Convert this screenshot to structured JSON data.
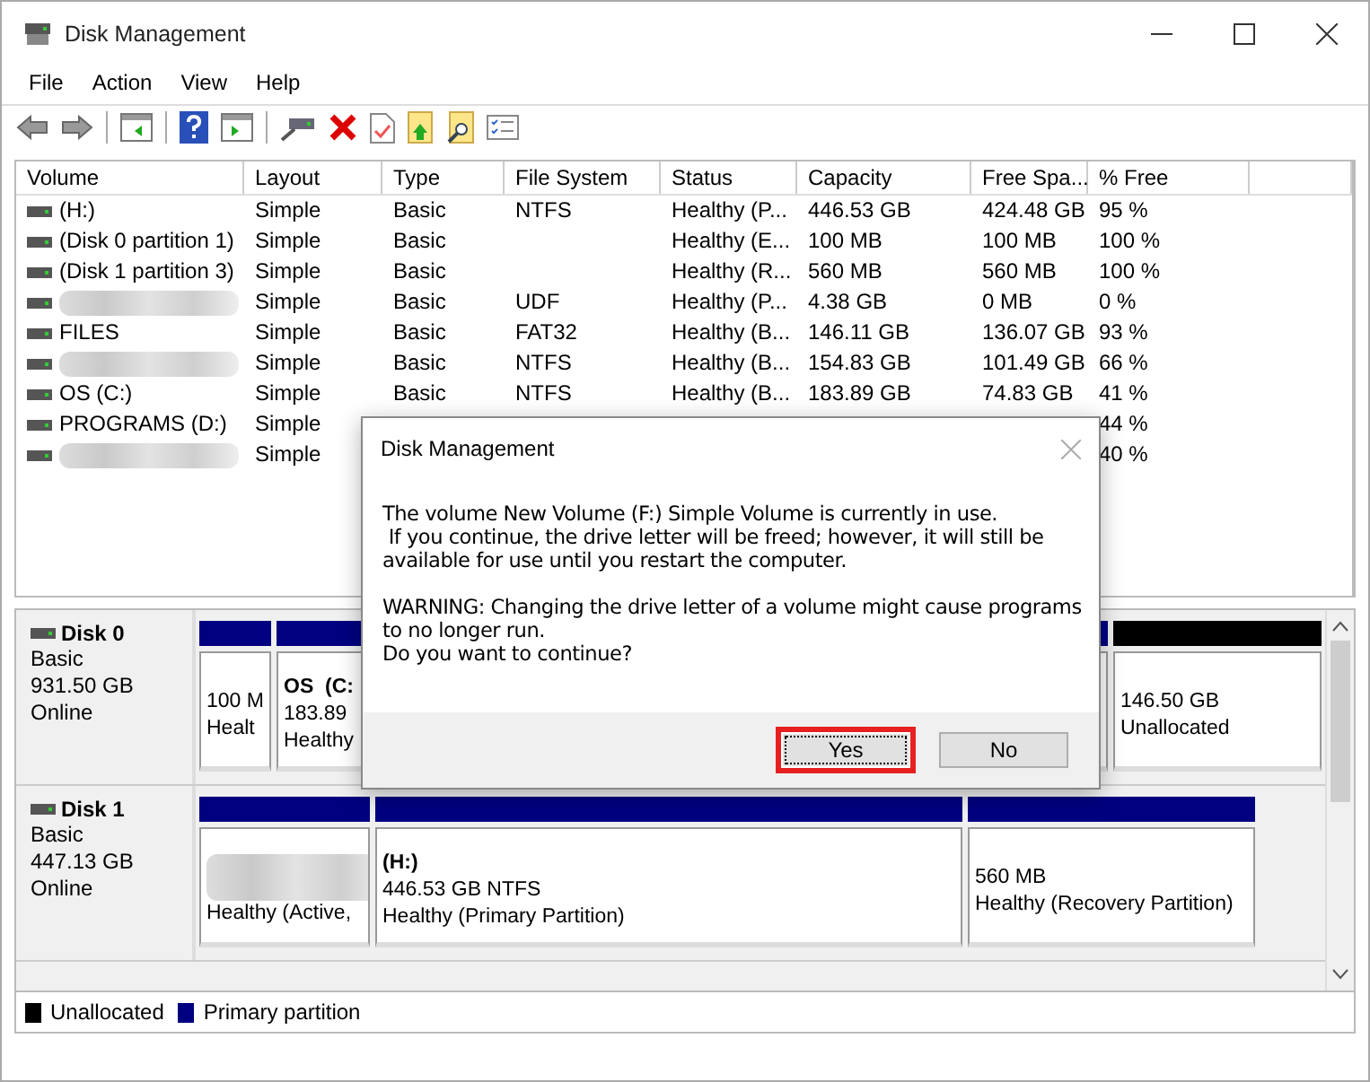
{
  "window": {
    "title": "Disk Management"
  },
  "menu": [
    "File",
    "Action",
    "View",
    "Help"
  ],
  "volumes": {
    "columns": [
      "Volume",
      "Layout",
      "Type",
      "File System",
      "Status",
      "Capacity",
      "Free Spa...",
      "% Free"
    ],
    "rows": [
      {
        "volume": "(H:)",
        "layout": "Simple",
        "type": "Basic",
        "file_system": "NTFS",
        "status": "Healthy (P...",
        "capacity": "446.53 GB",
        "free_space": "424.48 GB",
        "percent_free": "95 %"
      },
      {
        "volume": "(Disk 0 partition 1)",
        "layout": "Simple",
        "type": "Basic",
        "status": "Healthy (E...",
        "capacity": "100 MB",
        "free_space": "100 MB",
        "percent_free": "100 %"
      },
      {
        "volume": "(Disk 1 partition 3)",
        "layout": "Simple",
        "type": "Basic",
        "status": "Healthy (R...",
        "capacity": "560 MB",
        "free_space": "560 MB",
        "percent_free": "100 %"
      },
      {
        "redacted": true,
        "layout": "Simple",
        "type": "Basic",
        "file_system": "UDF",
        "status": "Healthy (P...",
        "capacity": "4.38 GB",
        "free_space": "0 MB",
        "percent_free": "0 %"
      },
      {
        "volume": "FILES",
        "layout": "Simple",
        "type": "Basic",
        "file_system": "FAT32",
        "status": "Healthy (B...",
        "capacity": "146.11 GB",
        "free_space": "136.07 GB",
        "percent_free": "93 %"
      },
      {
        "redacted": true,
        "layout": "Simple",
        "type": "Basic",
        "file_system": "NTFS",
        "status": "Healthy (B...",
        "capacity": "154.83 GB",
        "free_space": "101.49 GB",
        "percent_free": "66 %"
      },
      {
        "volume": "OS (C:)",
        "layout": "Simple",
        "type": "Basic",
        "file_system": "NTFS",
        "status": "Healthy (B...",
        "capacity": "183.89 GB",
        "free_space": "74.83 GB",
        "percent_free": "41 %"
      },
      {
        "volume": "PROGRAMS (D:)",
        "layout": "Simple",
        "percent_free": "44 %"
      },
      {
        "redacted": true,
        "layout": "Simple",
        "percent_free": "40 %"
      }
    ]
  },
  "disks": [
    {
      "name": "Disk 0",
      "type": "Basic",
      "size": "931.50 GB",
      "state": "Online",
      "partitions": [
        {
          "kind": "primary",
          "lines": [
            "100 M",
            "Healt"
          ]
        },
        {
          "kind": "primary",
          "lines": [
            "OS  (C:",
            "183.89",
            "Healthy"
          ],
          "bold_first": true
        },
        {
          "kind": "unallocated",
          "lines": [
            "146.50 GB",
            "Unallocated"
          ]
        }
      ]
    },
    {
      "name": "Disk 1",
      "type": "Basic",
      "size": "447.13 GB",
      "state": "Online",
      "partitions": [
        {
          "kind": "primary",
          "redacted": true,
          "lines": [
            "Healthy (Active,"
          ]
        },
        {
          "kind": "primary",
          "lines": [
            "(H:)",
            "446.53 GB NTFS",
            "Healthy (Primary Partition)"
          ],
          "bold_first": true
        },
        {
          "kind": "primary",
          "lines": [
            "560 MB",
            "Healthy (Recovery Partition)"
          ]
        }
      ]
    }
  ],
  "legend": [
    {
      "label": "Unallocated",
      "color": "#000000"
    },
    {
      "label": "Primary partition",
      "color": "#000080"
    }
  ],
  "dialog": {
    "title": "Disk Management",
    "paragraphs": [
      [
        "The volume New Volume (F:) Simple Volume is currently in use.",
        " If you continue, the drive letter will be freed; however, it will still be",
        "available for use until you restart the computer."
      ],
      [
        "WARNING: Changing the drive letter of a volume might cause programs",
        "to no longer run.",
        "Do you want to continue?"
      ]
    ],
    "buttons": [
      {
        "label": "Yes",
        "highlighted": true
      },
      {
        "label": "No",
        "highlighted": false
      }
    ]
  }
}
